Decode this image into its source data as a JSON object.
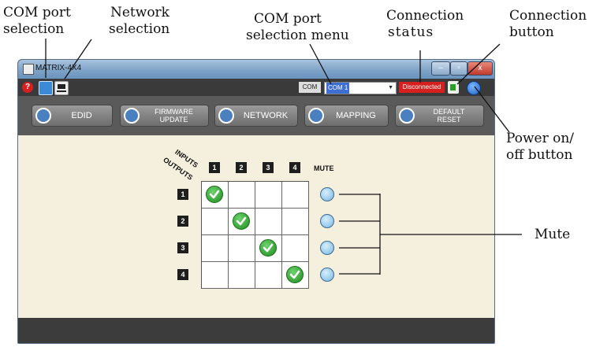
{
  "annotations": {
    "com_port_selection": [
      "COM port",
      "selection"
    ],
    "network_selection": [
      "Network",
      "selection"
    ],
    "com_port_menu": [
      "COM  port",
      "selection menu"
    ],
    "connection_status": [
      "Connection",
      "status"
    ],
    "connection_button": [
      "Connection",
      "button"
    ],
    "power_button": [
      "Power on/",
      "off button"
    ],
    "mute": "Mute"
  },
  "window": {
    "title": "MATRIX-4X4",
    "minimize": "–",
    "maximize": "▫",
    "close": "x"
  },
  "toolbar": {
    "help_icon": "help-icon",
    "com_label": "COM",
    "com_value": "COM 1",
    "status": "Disconnected"
  },
  "nav": [
    {
      "label": "EDID",
      "icon": "edid-icon"
    },
    {
      "label_lines": [
        "FIRMWARE",
        "UPDATE"
      ],
      "icon": "upload-arrow-icon"
    },
    {
      "label": "NETWORK",
      "icon": "wifi-icon"
    },
    {
      "label": "MAPPING",
      "icon": "pin-icon"
    },
    {
      "label_lines": [
        "DEFAULT",
        "RESET"
      ],
      "icon": "reset-icon"
    }
  ],
  "matrix": {
    "inputs_label": "INPUTS",
    "outputs_label": "OUTPUTS",
    "mute_label": "MUTE",
    "inputs": [
      "1",
      "2",
      "3",
      "4"
    ],
    "outputs": [
      "1",
      "2",
      "3",
      "4"
    ],
    "routing": [
      1,
      2,
      3,
      4
    ]
  },
  "colors": {
    "status_red": "#d62020",
    "check_green": "#2ea82e",
    "mute_blue": "#9fd0f0",
    "content_bg": "#f5f0dd"
  }
}
